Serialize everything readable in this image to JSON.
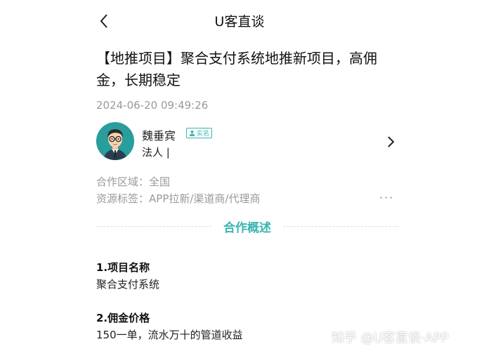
{
  "nav": {
    "title": "U客直谈"
  },
  "article": {
    "title": "【地推项目】聚合支付系统地推新项目，高佣金，长期稳定",
    "timestamp": "2024-06-20 09:49:26"
  },
  "author": {
    "name": "魏垂宾",
    "badge": "实名",
    "role": "法人 |"
  },
  "meta": {
    "region_label": "合作区域：",
    "region_value": "全国",
    "tags_label": "资源标签：",
    "tags_value": "APP拉新/渠道商/代理商",
    "more": "···"
  },
  "overview": {
    "section_title": "合作概述",
    "items": [
      {
        "heading": "1.项目名称",
        "text": "聚合支付系统"
      },
      {
        "heading": "2.佣金价格",
        "text": "150一单，流水万十的管道收益"
      }
    ]
  },
  "watermark": "知乎 @U客直谈·APP",
  "colors": {
    "accent": "#3ab5b0",
    "muted": "#999999"
  },
  "icons": {
    "back": "chevron-left-icon",
    "badge": "person-icon",
    "author_arrow": "chevron-right-icon"
  }
}
